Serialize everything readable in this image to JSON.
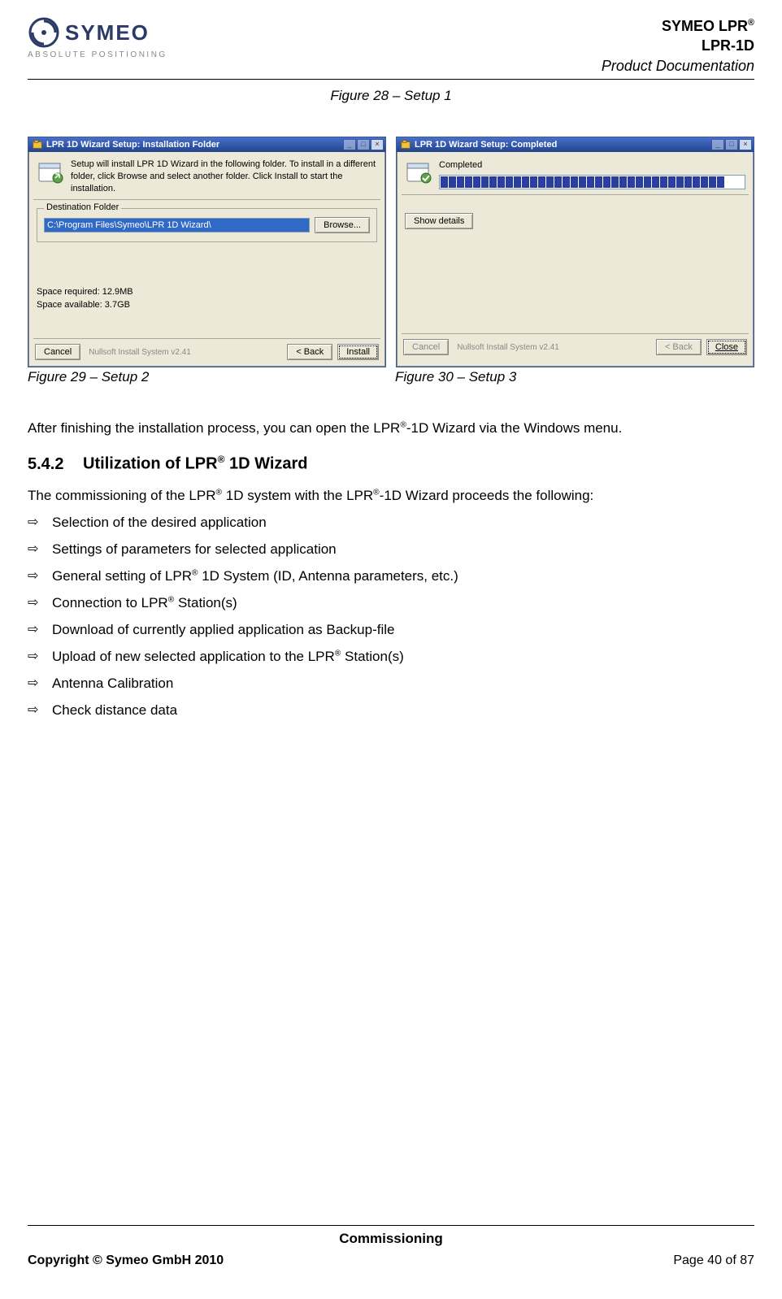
{
  "header": {
    "logo_name": "SYMEO",
    "logo_tag": "ABSOLUTE POSITIONING",
    "right1_pre": "SYMEO LPR",
    "right2": "LPR-1D",
    "right3": "Product Documentation"
  },
  "fig28": "Figure 28 – Setup 1",
  "installer_left": {
    "title": "LPR 1D Wizard Setup: Installation Folder",
    "desc": "Setup will install LPR 1D Wizard in the following folder. To install in a different folder, click Browse and select another folder. Click Install to start the installation.",
    "legend": "Destination Folder",
    "path": "C:\\Program Files\\Symeo\\LPR 1D Wizard\\",
    "browse": "Browse...",
    "space_req": "Space required: 12.9MB",
    "space_avail": "Space available: 3.7GB",
    "cancel": "Cancel",
    "nsis": "Nullsoft Install System v2.41",
    "back": "< Back",
    "install": "Install"
  },
  "installer_right": {
    "title": "LPR 1D Wizard Setup: Completed",
    "completed": "Completed",
    "show_details": "Show details",
    "cancel": "Cancel",
    "nsis": "Nullsoft Install System v2.41",
    "back": "< Back",
    "close": "Close"
  },
  "fig29": "Figure 29 – Setup 2",
  "fig30": "Figure 30 – Setup 3",
  "para1_pre": "After finishing the installation process, you can open the LPR",
  "para1_post": "-1D Wizard via the Windows menu.",
  "heading_no": "5.4.2",
  "heading_pre": "Utilization of LPR",
  "heading_post": " 1D Wizard",
  "para2_pre": "The commissioning of the LPR",
  "para2_mid": " 1D system with the LPR",
  "para2_post": "-1D Wizard proceeds the following:",
  "list": {
    "a": "Selection of the desired application",
    "b": "Settings of parameters for selected application",
    "c_pre": "General setting of LPR",
    "c_post": " 1D System (ID, Antenna parameters, etc.)",
    "d_pre": "Connection to LPR",
    "d_post": " Station(s)",
    "e": "Download of currently applied application as Backup-file",
    "f_pre": "Upload of new selected application to the LPR",
    "f_post": " Station(s)",
    "g": "Antenna Calibration",
    "h": "Check distance data"
  },
  "footer": {
    "mid": "Commissioning",
    "copyright": "Copyright © Symeo GmbH 2010",
    "page": "Page 40 of 87"
  },
  "icons": {
    "min": "_",
    "max": "□",
    "close": "×",
    "arrow": "⇨"
  }
}
